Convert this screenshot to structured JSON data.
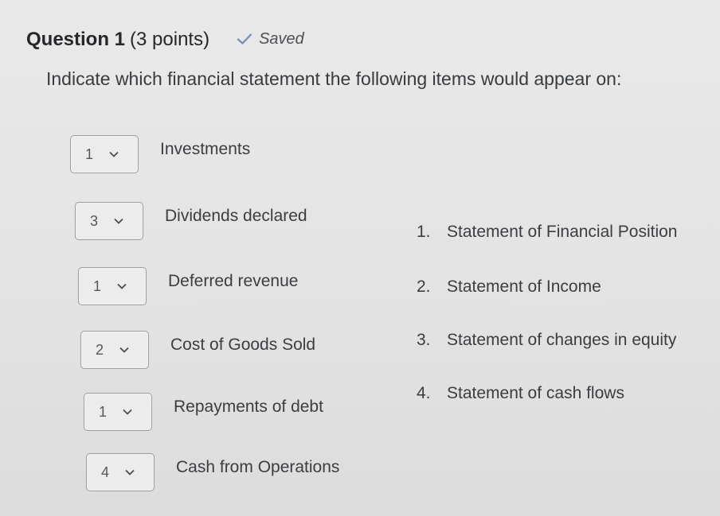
{
  "question": {
    "title": "Question 1",
    "points": "(3 points)",
    "saved_label": "Saved",
    "prompt": "Indicate which financial statement the following items would appear on:"
  },
  "items": [
    {
      "selected": "1",
      "label": "Investments"
    },
    {
      "selected": "3",
      "label": "Dividends declared"
    },
    {
      "selected": "1",
      "label": "Deferred revenue"
    },
    {
      "selected": "2",
      "label": "Cost of Goods Sold"
    },
    {
      "selected": "1",
      "label": "Repayments of debt"
    },
    {
      "selected": "4",
      "label": "Cash from Operations"
    }
  ],
  "answers": [
    {
      "number": "1.",
      "label": "Statement of Financial Position"
    },
    {
      "number": "2.",
      "label": "Statement of Income"
    },
    {
      "number": "3.",
      "label": "Statement of changes in equity"
    },
    {
      "number": "4.",
      "label": "Statement of cash flows"
    }
  ],
  "colors": {
    "saved_check": "#6b8fbf",
    "select_border": "#9b9da1",
    "text": "#3c3d41"
  }
}
